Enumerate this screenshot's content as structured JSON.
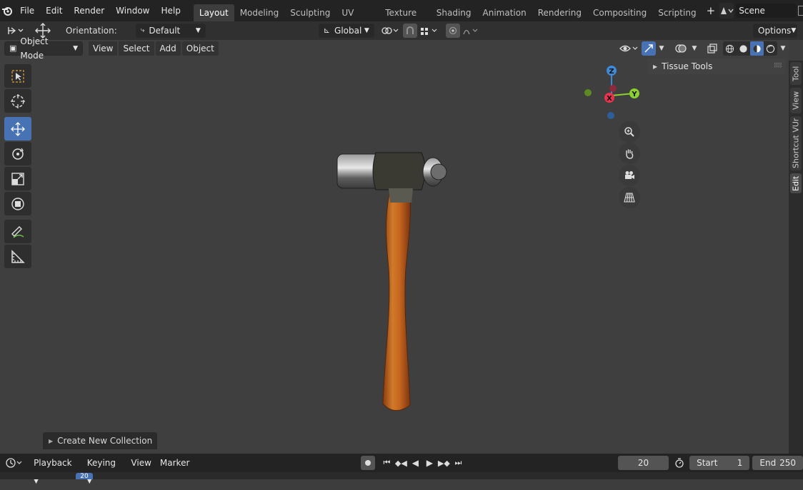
{
  "topbar": {
    "menus": [
      "File",
      "Edit",
      "Render",
      "Window",
      "Help"
    ],
    "workspaces": [
      "Layout",
      "Modeling",
      "Sculpting",
      "UV Editing",
      "Texture Paint",
      "Shading",
      "Animation",
      "Rendering",
      "Compositing",
      "Scripting"
    ],
    "active_workspace": "Layout",
    "add_tab": "+",
    "scene_name": "Scene"
  },
  "tool_header": {
    "orientation_label": "Orientation:",
    "orientation_value": "Default",
    "transform_space": "Global",
    "options_label": "Options"
  },
  "viewport_header": {
    "mode": "Object Mode",
    "menus": [
      "View",
      "Select",
      "Add",
      "Object"
    ]
  },
  "gizmo": {
    "z": "Z",
    "y": "Y",
    "x": "X"
  },
  "sidebar": {
    "panel_title": "Tissue Tools",
    "tabs": [
      "Tool",
      "View",
      "Shortcut VUr",
      "Edit"
    ],
    "active_tab": "Edit"
  },
  "operator_panel": {
    "label": "Create New Collection"
  },
  "timeline": {
    "menus": [
      "Playback",
      "Keying",
      "View",
      "Marker"
    ],
    "current_frame": "20",
    "start_label": "Start",
    "start_value": "1",
    "end_label": "End",
    "end_value": "250",
    "ruler_marker": "20"
  },
  "colors": {
    "accent": "#4772b3",
    "axis_x": "#e8344e",
    "axis_y": "#8cd12e",
    "axis_z": "#3d8ad6"
  }
}
